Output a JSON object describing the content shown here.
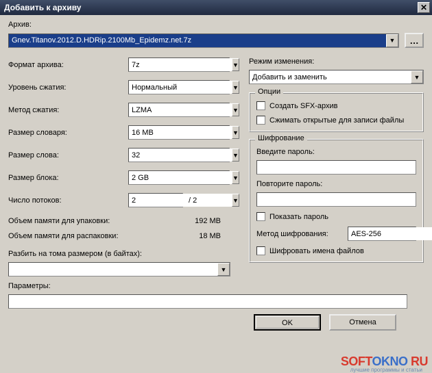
{
  "title": "Добавить к архиву",
  "archive_label": "Архив:",
  "archive_value": "Gnev.Titanov.2012.D.HDRip.2100Mb_Epidemz.net.7z",
  "left": {
    "format_label": "Формат архива:",
    "format_value": "7z",
    "level_label": "Уровень сжатия:",
    "level_value": "Нормальный",
    "method_label": "Метод сжатия:",
    "method_value": "LZMA",
    "dict_label": "Размер словаря:",
    "dict_value": "16 MB",
    "word_label": "Размер слова:",
    "word_value": "32",
    "block_label": "Размер блока:",
    "block_value": "2 GB",
    "threads_label": "Число потоков:",
    "threads_value": "2",
    "threads_total": "/ 2",
    "pack_mem_label": "Объем памяти для упаковки:",
    "pack_mem_value": "192 MB",
    "unpack_mem_label": "Объем памяти для распаковки:",
    "unpack_mem_value": "18 MB",
    "split_label": "Разбить на тома размером (в байтах):",
    "split_value": ""
  },
  "right": {
    "update_label": "Режим изменения:",
    "update_value": "Добавить и заменить",
    "options_legend": "Опции",
    "sfx_label": "Создать SFX-архив",
    "open_label": "Сжимать открытые для записи файлы",
    "enc_legend": "Шифрование",
    "pwd_label": "Введите пароль:",
    "pwd2_label": "Повторите пароль:",
    "show_pwd_label": "Показать пароль",
    "enc_method_label": "Метод шифрования:",
    "enc_method_value": "AES-256",
    "enc_names_label": "Шифровать имена файлов"
  },
  "params_label": "Параметры:",
  "buttons": {
    "ok": "OK",
    "cancel": "Отмена"
  },
  "watermark": {
    "p1": "SOFT",
    "p2": "OKNO",
    "p3": "RU",
    "sub": "лучшие программы и статьи"
  }
}
